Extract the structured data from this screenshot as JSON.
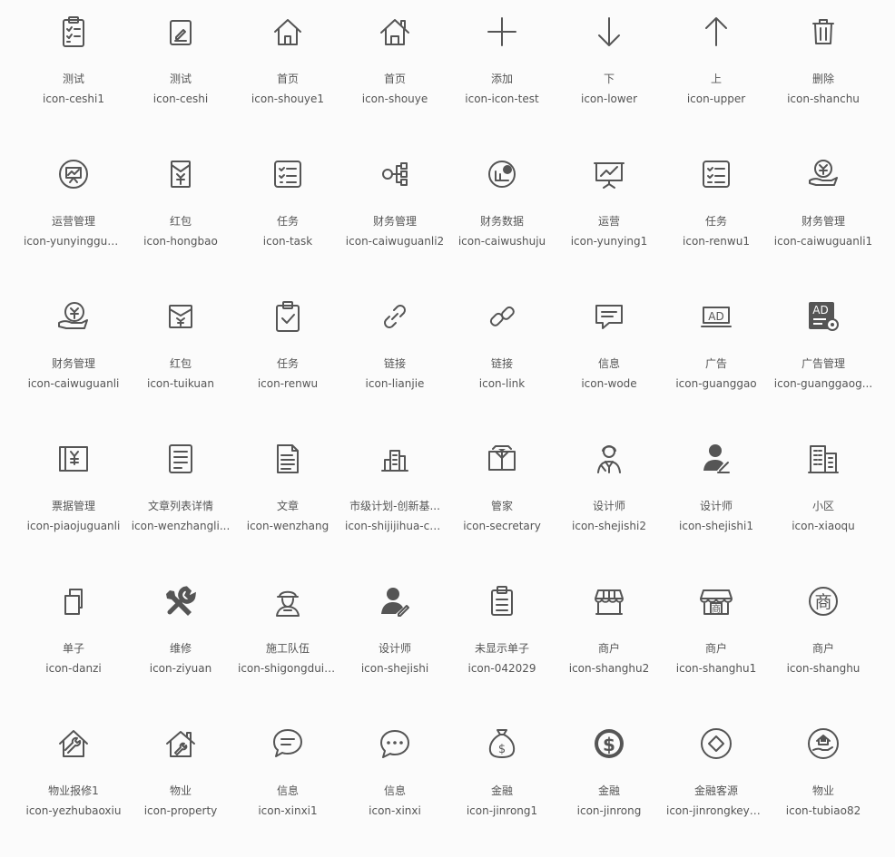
{
  "icons": [
    {
      "cn": "测试",
      "code": "icon-ceshi1",
      "glyph": "clipboard-check-icon"
    },
    {
      "cn": "测试",
      "code": "icon-ceshi",
      "glyph": "clipboard-edit-icon"
    },
    {
      "cn": "首页",
      "code": "icon-shouye1",
      "glyph": "home-icon"
    },
    {
      "cn": "首页",
      "code": "icon-shouye",
      "glyph": "home-chimney-icon"
    },
    {
      "cn": "添加",
      "code": "icon-icon-test",
      "glyph": "plus-icon"
    },
    {
      "cn": "下",
      "code": "icon-lower",
      "glyph": "arrow-down-icon"
    },
    {
      "cn": "上",
      "code": "icon-upper",
      "glyph": "arrow-up-icon"
    },
    {
      "cn": "删除",
      "code": "icon-shanchu",
      "glyph": "trash-icon"
    },
    {
      "cn": "运营管理",
      "code": "icon-yunyingguanli",
      "glyph": "chart-circle-icon"
    },
    {
      "cn": "红包",
      "code": "icon-hongbao",
      "glyph": "red-envelope-icon"
    },
    {
      "cn": "任务",
      "code": "icon-task",
      "glyph": "task-list-icon"
    },
    {
      "cn": "财务管理",
      "code": "icon-caiwuguanli2",
      "glyph": "finance-tree-icon"
    },
    {
      "cn": "财务数据",
      "code": "icon-caiwushuju",
      "glyph": "finance-data-icon"
    },
    {
      "cn": "运营",
      "code": "icon-yunying1",
      "glyph": "presentation-board-icon"
    },
    {
      "cn": "任务",
      "code": "icon-renwu1",
      "glyph": "checklist-icon"
    },
    {
      "cn": "财务管理",
      "code": "icon-caiwuguanli1",
      "glyph": "yuan-hand-icon"
    },
    {
      "cn": "财务管理",
      "code": "icon-caiwuguanli",
      "glyph": "yuan-hand-outline-icon"
    },
    {
      "cn": "红包",
      "code": "icon-tuikuan",
      "glyph": "refund-envelope-icon"
    },
    {
      "cn": "任务",
      "code": "icon-renwu",
      "glyph": "clipboard-tick-icon"
    },
    {
      "cn": "链接",
      "code": "icon-lianjie",
      "glyph": "link-icon"
    },
    {
      "cn": "链接",
      "code": "icon-link",
      "glyph": "link-alt-icon"
    },
    {
      "cn": "信息",
      "code": "icon-wode",
      "glyph": "message-icon"
    },
    {
      "cn": "广告",
      "code": "icon-guanggao",
      "glyph": "ad-icon"
    },
    {
      "cn": "广告管理",
      "code": "icon-guanggaog...",
      "glyph": "ad-settings-icon"
    },
    {
      "cn": "票据管理",
      "code": "icon-piaojuguanli",
      "glyph": "bill-icon"
    },
    {
      "cn": "文章列表详情",
      "code": "icon-wenzhangli...",
      "glyph": "article-list-icon"
    },
    {
      "cn": "文章",
      "code": "icon-wenzhang",
      "glyph": "document-icon"
    },
    {
      "cn": "市级计划-创新基...",
      "code": "icon-shijijihua-ch...",
      "glyph": "buildings-icon"
    },
    {
      "cn": "管家",
      "code": "icon-secretary",
      "glyph": "butler-icon"
    },
    {
      "cn": "设计师",
      "code": "icon-shejishi2",
      "glyph": "designer-icon"
    },
    {
      "cn": "设计师",
      "code": "icon-shejishi1",
      "glyph": "designer-pen-icon"
    },
    {
      "cn": "小区",
      "code": "icon-xiaoqu",
      "glyph": "community-icon"
    },
    {
      "cn": "单子",
      "code": "icon-danzi",
      "glyph": "copy-icon"
    },
    {
      "cn": "维修",
      "code": "icon-ziyuan",
      "glyph": "tools-icon"
    },
    {
      "cn": "施工队伍",
      "code": "icon-shigongduiwu",
      "glyph": "worker-icon"
    },
    {
      "cn": "设计师",
      "code": "icon-shejishi",
      "glyph": "user-edit-icon"
    },
    {
      "cn": "未显示单子",
      "code": "icon-042029",
      "glyph": "clipboard-lines-icon"
    },
    {
      "cn": "商户",
      "code": "icon-shanghu2",
      "glyph": "shop-icon"
    },
    {
      "cn": "商户",
      "code": "icon-shanghu1",
      "glyph": "store-icon"
    },
    {
      "cn": "商户",
      "code": "icon-shanghu",
      "glyph": "shang-circle-icon"
    },
    {
      "cn": "物业报修1",
      "code": "icon-yezhubaoxiu",
      "glyph": "house-wrench-icon"
    },
    {
      "cn": "物业",
      "code": "icon-property",
      "glyph": "house-tool-icon"
    },
    {
      "cn": "信息",
      "code": "icon-xinxi1",
      "glyph": "chat-bubble-icon"
    },
    {
      "cn": "信息",
      "code": "icon-xinxi",
      "glyph": "chat-dots-icon"
    },
    {
      "cn": "金融",
      "code": "icon-jinrong1",
      "glyph": "money-bag-icon"
    },
    {
      "cn": "金融",
      "code": "icon-jinrong",
      "glyph": "dollar-circle-icon"
    },
    {
      "cn": "金融客源",
      "code": "icon-jinrongkeyu...",
      "glyph": "diamond-circle-icon"
    },
    {
      "cn": "物业",
      "code": "icon-tubiao82",
      "glyph": "property-hand-icon"
    }
  ],
  "colors": {
    "icon": "#555555",
    "text": "#555555",
    "background": "#fbfbfb"
  }
}
